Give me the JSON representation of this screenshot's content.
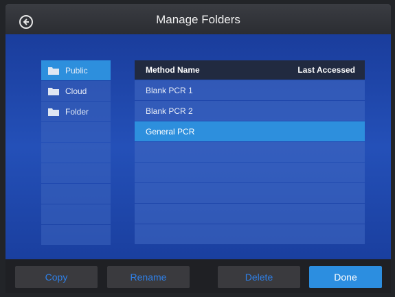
{
  "header": {
    "title": "Manage Folders",
    "back_icon": "back-arrow-icon"
  },
  "folders": [
    {
      "label": "Public",
      "selected": true,
      "icon": "folder-icon"
    },
    {
      "label": "Cloud",
      "selected": false,
      "icon": "folder-icon"
    },
    {
      "label": "Folder",
      "selected": false,
      "icon": "folder-icon"
    },
    {
      "label": ""
    },
    {
      "label": ""
    },
    {
      "label": ""
    },
    {
      "label": ""
    },
    {
      "label": ""
    },
    {
      "label": ""
    }
  ],
  "methods": {
    "columns": {
      "name": "Method Name",
      "accessed": "Last Accessed"
    },
    "rows": [
      {
        "name": "Blank PCR 1",
        "selected": false
      },
      {
        "name": "Blank PCR 2",
        "selected": false
      },
      {
        "name": "General PCR",
        "selected": true
      },
      {
        "name": ""
      },
      {
        "name": ""
      },
      {
        "name": ""
      },
      {
        "name": ""
      },
      {
        "name": ""
      }
    ]
  },
  "footer": {
    "copy_label": "Copy",
    "rename_label": "Rename",
    "delete_label": "Delete",
    "done_label": "Done"
  },
  "colors": {
    "accent": "#2d8fdd",
    "background": "#1a3d9c",
    "disabled_text": "#2f80e8"
  }
}
